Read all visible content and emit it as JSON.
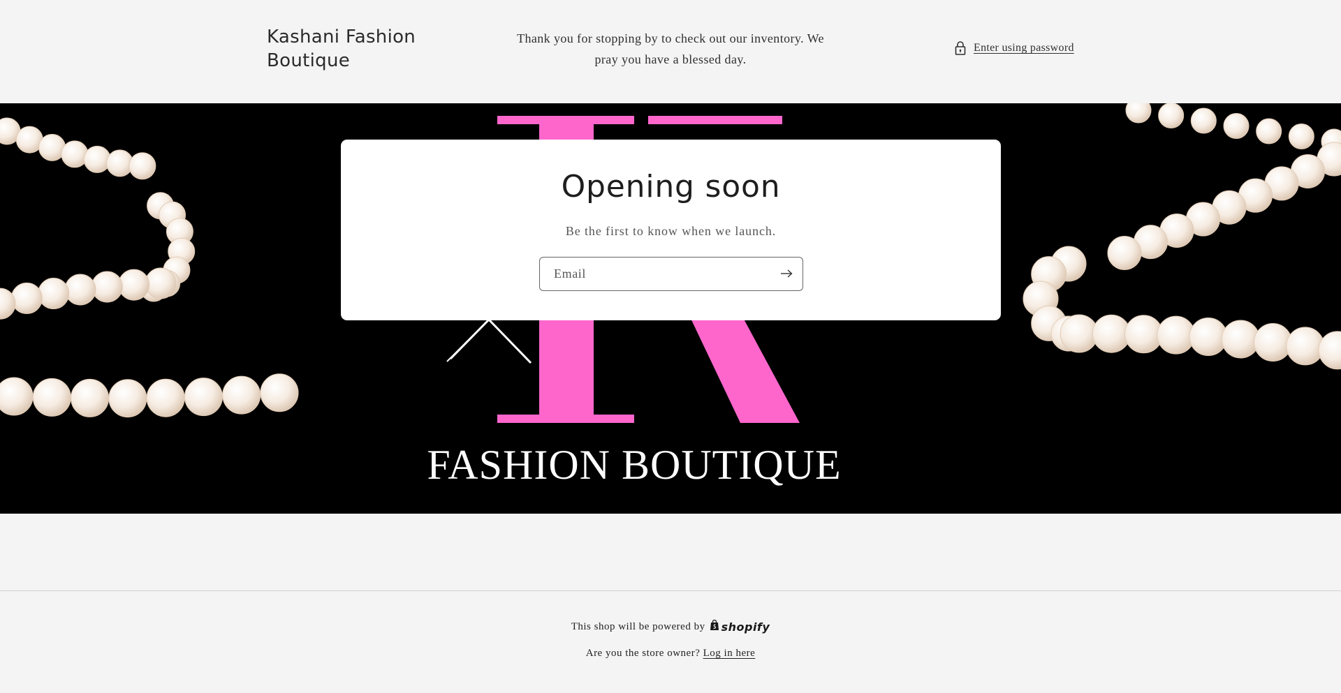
{
  "header": {
    "store_name": "Kashani Fashion Boutique",
    "message": "Thank you for stopping by to check out our inventory. We pray you have a blessed day.",
    "password_link": "Enter using password"
  },
  "banner": {
    "logo_letter": "K",
    "logo_text": "FASHION BOUTIQUE",
    "accent_color": "#ff66cc"
  },
  "card": {
    "title": "Opening soon",
    "subtitle": "Be the first to know when we launch.",
    "email_placeholder": "Email"
  },
  "footer": {
    "powered_text": "This shop will be powered by",
    "shopify_label": "shopify",
    "owner_text": "Are you the store owner?",
    "login_link": "Log in here"
  },
  "icons": {
    "lock": "lock-icon",
    "arrow": "arrow-right-icon",
    "shopify_bag": "shopify-bag-icon"
  }
}
